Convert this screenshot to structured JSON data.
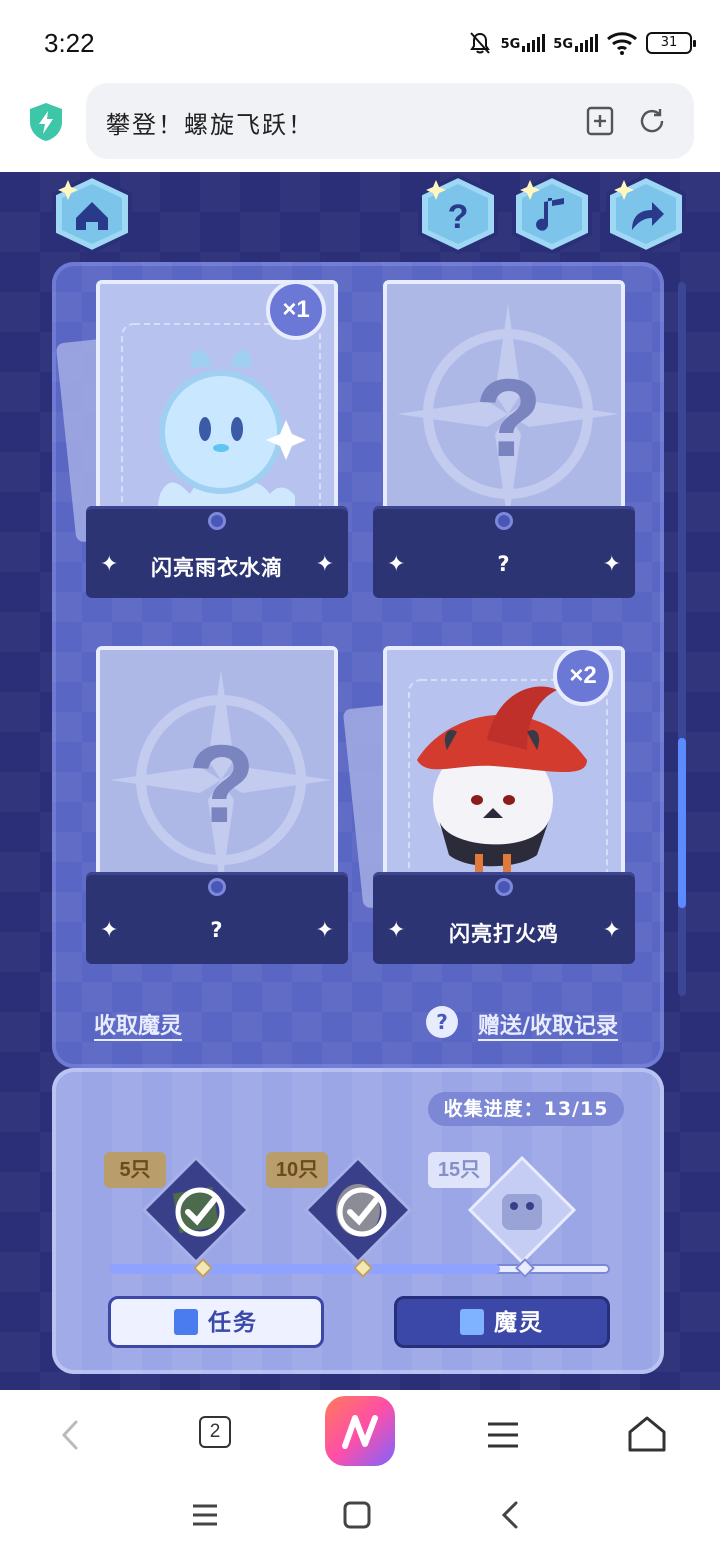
{
  "status_bar": {
    "time": "3:22",
    "network_1": "5G",
    "network_2": "5G",
    "battery": "31"
  },
  "browser": {
    "page_title": "攀登！螺旋飞跃！",
    "tab_count": "2"
  },
  "game": {
    "cards": [
      {
        "name": "闪亮雨衣水滴",
        "count": "×1",
        "owned": true
      },
      {
        "name": "?",
        "count": "",
        "owned": false
      },
      {
        "name": "?",
        "count": "",
        "owned": false
      },
      {
        "name": "闪亮打火鸡",
        "count": "×2",
        "owned": true
      }
    ],
    "links": {
      "collect": "收取魔灵",
      "record": "赠送/收取记录",
      "help": "?"
    },
    "progress": {
      "label": "收集进度：",
      "value": "13/15",
      "current": 13,
      "total": 15,
      "milestones": [
        {
          "tag": "5只",
          "done": true
        },
        {
          "tag": "10只",
          "done": true
        },
        {
          "tag": "15只",
          "done": false
        }
      ]
    },
    "buttons": {
      "task": "任务",
      "spirit": "魔灵"
    }
  },
  "colors": {
    "game_bg": "#2a2f78",
    "panel": "#5a66c4",
    "card_base": "#2d3474",
    "accent_blue": "#3b48a8"
  }
}
